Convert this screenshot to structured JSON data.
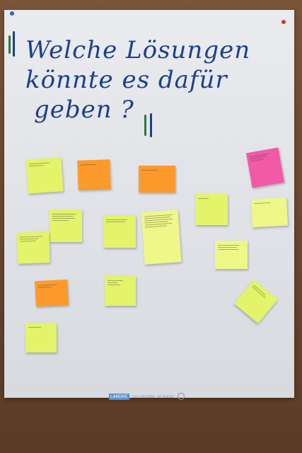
{
  "title": {
    "lines": [
      "Welche Lösungen",
      "könnte es dafür",
      "geben ?"
    ]
  },
  "footer": {
    "logo": "LANDRÉ",
    "tag": "FÜR CHARTMEN · IST PERFEKT"
  },
  "colors": {
    "title_ink": "#1d3f8c",
    "accent_ink": "#2a7a3a",
    "note_yellow": "#e3f36a",
    "note_orange": "#fd9a2c",
    "note_pink": "#f25aa7"
  },
  "notes": [
    {
      "color": "yellow"
    },
    {
      "color": "orange"
    },
    {
      "color": "orange"
    },
    {
      "color": "pink"
    },
    {
      "color": "yellow"
    },
    {
      "color": "yellow"
    },
    {
      "color": "yellow"
    },
    {
      "color": "yellow"
    },
    {
      "color": "yellow"
    },
    {
      "color": "yellow"
    },
    {
      "color": "yellow"
    },
    {
      "color": "orange"
    },
    {
      "color": "yellow"
    },
    {
      "color": "yellow"
    },
    {
      "color": "yellow"
    }
  ]
}
